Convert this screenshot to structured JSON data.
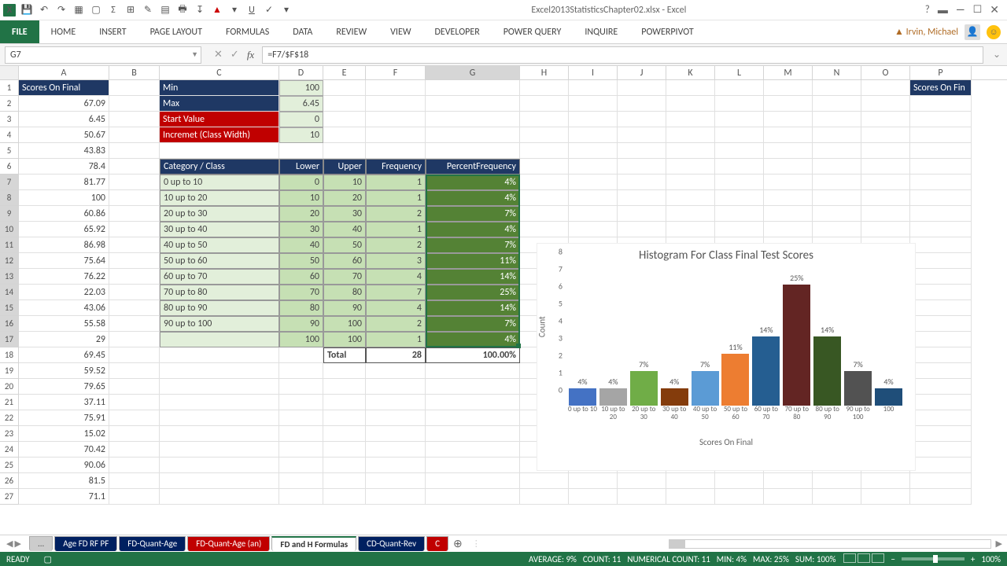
{
  "title": "Excel2013StatisticsChapter02.xlsx - Excel",
  "user": "Irvin, Michael",
  "ribbon_tabs": [
    "FILE",
    "HOME",
    "INSERT",
    "PAGE LAYOUT",
    "FORMULAS",
    "DATA",
    "REVIEW",
    "VIEW",
    "DEVELOPER",
    "POWER QUERY",
    "INQUIRE",
    "POWERPIVOT"
  ],
  "name_box": "G7",
  "formula": "=F7/$F$18",
  "columns": [
    "A",
    "B",
    "C",
    "D",
    "E",
    "F",
    "G",
    "H",
    "I",
    "J",
    "K",
    "L",
    "M",
    "N",
    "O",
    "P"
  ],
  "a_header": "Scores On Final",
  "p_header": "Scores On Fin",
  "scores": [
    67.09,
    6.45,
    50.67,
    43.83,
    78.4,
    81.77,
    100,
    60.86,
    65.92,
    86.98,
    75.64,
    76.22,
    22.03,
    43.06,
    55.58,
    29,
    69.45,
    59.52,
    79.65,
    37.11,
    75.91,
    15.02,
    70.42,
    90.06,
    81.5,
    71.1
  ],
  "params": [
    {
      "label": "Min",
      "value": 100,
      "cls": "hdr-dark"
    },
    {
      "label": "Max",
      "value": 6.45,
      "cls": "hdr-dark"
    },
    {
      "label": "Start Value",
      "value": 0,
      "cls": "hdr-red"
    },
    {
      "label": "Incremet (Class Width)",
      "value": 10,
      "cls": "hdr-red"
    }
  ],
  "table_headers": [
    "Category / Class",
    "Lower",
    "Upper",
    "Frequency",
    "PercentFrequency"
  ],
  "table": [
    {
      "cat": "0 up to 10",
      "low": 0,
      "up": 10,
      "freq": 1,
      "pct": "4%"
    },
    {
      "cat": "10 up to 20",
      "low": 10,
      "up": 20,
      "freq": 1,
      "pct": "4%"
    },
    {
      "cat": "20 up to 30",
      "low": 20,
      "up": 30,
      "freq": 2,
      "pct": "7%"
    },
    {
      "cat": "30 up to 40",
      "low": 30,
      "up": 40,
      "freq": 1,
      "pct": "4%"
    },
    {
      "cat": "40 up to 50",
      "low": 40,
      "up": 50,
      "freq": 2,
      "pct": "7%"
    },
    {
      "cat": "50 up to 60",
      "low": 50,
      "up": 60,
      "freq": 3,
      "pct": "11%"
    },
    {
      "cat": "60 up to 70",
      "low": 60,
      "up": 70,
      "freq": 4,
      "pct": "14%"
    },
    {
      "cat": "70 up to 80",
      "low": 70,
      "up": 80,
      "freq": 7,
      "pct": "25%"
    },
    {
      "cat": "80 up to 90",
      "low": 80,
      "up": 90,
      "freq": 4,
      "pct": "14%"
    },
    {
      "cat": "90 up to 100",
      "low": 90,
      "up": 100,
      "freq": 2,
      "pct": "7%"
    },
    {
      "cat": "",
      "low": 100,
      "up": 100,
      "freq": 1,
      "pct": "4%"
    }
  ],
  "total_label": "Total",
  "total_freq": 28,
  "total_pct": "100.00%",
  "sheet_tabs": [
    {
      "label": "...",
      "bg": "#ccc",
      "color": "#555"
    },
    {
      "label": "Age FD RF PF",
      "bg": "#002060",
      "color": "#fff"
    },
    {
      "label": "FD-Quant-Age",
      "bg": "#002060",
      "color": "#fff"
    },
    {
      "label": "FD-Quant-Age (an)",
      "bg": "#c00000",
      "color": "#fff"
    },
    {
      "label": "FD and H Formulas",
      "bg": "#fff",
      "color": "#333",
      "active": true
    },
    {
      "label": "CD-Quant-Rev",
      "bg": "#002060",
      "color": "#fff"
    },
    {
      "label": "C",
      "bg": "#c00000",
      "color": "#fff"
    }
  ],
  "status": {
    "ready": "READY",
    "average": "AVERAGE: 9%",
    "count": "COUNT: 11",
    "numcount": "NUMERICAL COUNT: 11",
    "min": "MIN: 4%",
    "max": "MAX: 25%",
    "sum": "SUM: 100%",
    "zoom": "100%"
  },
  "chart_data": {
    "type": "bar",
    "title": "Histogram For Class Final Test Scores",
    "xlabel": "Scores On Final",
    "ylabel": "Count",
    "ylim": [
      0,
      8
    ],
    "yticks": [
      0,
      1,
      2,
      3,
      4,
      5,
      6,
      7,
      8
    ],
    "categories": [
      "0 up to 10",
      "10 up to 20",
      "20 up to 30",
      "30 up to 40",
      "40 up to 50",
      "50 up to 60",
      "60 up to 70",
      "70 up to 80",
      "80 up to 90",
      "90 up to 100",
      "100"
    ],
    "values": [
      1,
      1,
      2,
      1,
      2,
      3,
      4,
      7,
      4,
      2,
      1
    ],
    "labels": [
      "4%",
      "4%",
      "7%",
      "4%",
      "7%",
      "11%",
      "14%",
      "25%",
      "14%",
      "7%",
      "4%"
    ],
    "colors": [
      "#4472c4",
      "#a5a5a5",
      "#70ad47",
      "#843c0c",
      "#5b9bd5",
      "#ed7d31",
      "#255e91",
      "#632523",
      "#385723",
      "#525252",
      "#1f4e79"
    ]
  }
}
